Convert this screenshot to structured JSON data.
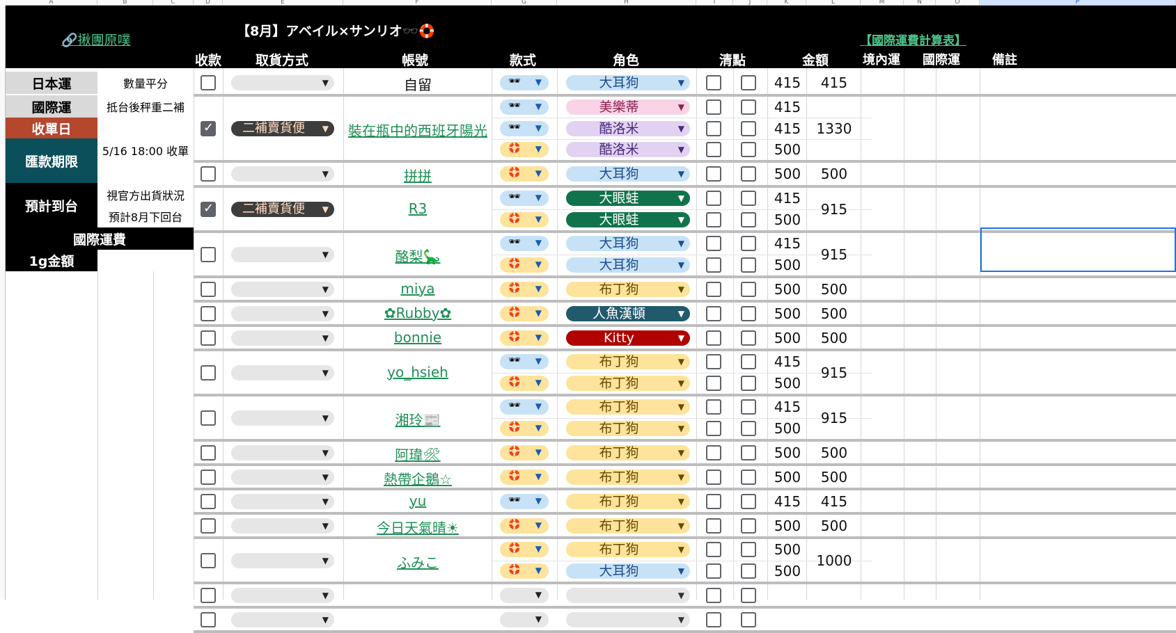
{
  "columns": [
    "A",
    "B",
    "C",
    "D",
    "E",
    "F",
    "G",
    "H",
    "I",
    "J",
    "K",
    "L",
    "M",
    "N",
    "O",
    "P"
  ],
  "header": {
    "link_left": "🔗揪團原噗",
    "title": "【8月】アベイル×サンリオ🕶️🛟",
    "link_right": "【國際運費計算表】",
    "cols": {
      "paid": "收款",
      "pickup": "取貨方式",
      "account": "帳號",
      "style": "款式",
      "character": "角色",
      "check": "清點",
      "amount": "金額",
      "domestic": "境內運",
      "intl": "國際運",
      "note": "備註"
    }
  },
  "info": {
    "jp_ship_label": "日本運",
    "jp_ship_val": "數量平分",
    "intl_ship_label": "國際運",
    "intl_ship_val": "抵台後秤重二補",
    "close_label": "收單日",
    "close_val": "5/16 18:00 收單",
    "pay_label": "匯款期限",
    "arrival_label": "預計到台",
    "arrival_val1": "視官方出貨狀況",
    "arrival_val2": "預計8月下回台",
    "intl_fee_label": "國際運費",
    "per_g_label": "1g金額"
  },
  "glyphs": {
    "glasses": "🕶",
    "ring": "🛟",
    "arrow": "▼"
  },
  "colors": {
    "blue_chip": "#c7e2f6",
    "pink_chip": "#f9d3e6",
    "purple_chip": "#e2d2f2",
    "green_chip": "#11734b",
    "orange_chip": "#fde39b",
    "teal_chip": "#215a6c",
    "red_chip": "#b10202",
    "dark_chip": "#3d3d3d",
    "gray_chip": "#e6e6e6",
    "close_red": "#b5472d",
    "pay_teal": "#0b4f5a"
  },
  "pickup_option": "二補賣貨便",
  "rows": [
    {
      "account": "自留",
      "link": false,
      "paid": false,
      "pickup": "",
      "total": "415",
      "items": [
        {
          "style": "glasses",
          "char": "大耳狗",
          "cc": "blue",
          "amt": "415"
        }
      ]
    },
    {
      "account": "裝在瓶中的西班牙陽光",
      "link": true,
      "paid": true,
      "pickup": "二補賣貨便",
      "total": "1330",
      "items": [
        {
          "style": "glasses",
          "char": "美樂蒂",
          "cc": "pink",
          "amt": "415"
        },
        {
          "style": "glasses",
          "char": "酷洛米",
          "cc": "purple",
          "amt": "415"
        },
        {
          "style": "ring",
          "char": "酷洛米",
          "cc": "purple",
          "amt": "500"
        }
      ]
    },
    {
      "account": "拼拼",
      "link": true,
      "paid": false,
      "pickup": "",
      "total": "500",
      "items": [
        {
          "style": "ring",
          "char": "大耳狗",
          "cc": "blue",
          "amt": "500"
        }
      ]
    },
    {
      "account": "R3",
      "link": true,
      "paid": true,
      "pickup": "二補賣貨便",
      "total": "915",
      "items": [
        {
          "style": "glasses",
          "char": "大眼蛙",
          "cc": "green",
          "amt": "415"
        },
        {
          "style": "ring",
          "char": "大眼蛙",
          "cc": "green",
          "amt": "500"
        }
      ]
    },
    {
      "account": "酪梨🦕",
      "link": true,
      "paid": false,
      "pickup": "",
      "total": "915",
      "items": [
        {
          "style": "glasses",
          "char": "大耳狗",
          "cc": "blue",
          "amt": "415"
        },
        {
          "style": "ring",
          "char": "大耳狗",
          "cc": "blue",
          "amt": "500"
        }
      ]
    },
    {
      "account": "miya",
      "link": true,
      "paid": false,
      "pickup": "",
      "total": "500",
      "items": [
        {
          "style": "ring",
          "char": "布丁狗",
          "cc": "orange",
          "amt": "500"
        }
      ]
    },
    {
      "account": "✿Rubby✿",
      "link": true,
      "paid": false,
      "pickup": "",
      "total": "500",
      "items": [
        {
          "style": "ring",
          "char": "人魚漢頓",
          "cc": "teal",
          "amt": "500"
        }
      ]
    },
    {
      "account": "bonnie",
      "link": true,
      "paid": false,
      "pickup": "",
      "total": "500",
      "items": [
        {
          "style": "ring",
          "char": "Kitty",
          "cc": "red",
          "amt": "500"
        }
      ]
    },
    {
      "account": "yo_hsieh",
      "link": true,
      "paid": false,
      "pickup": "",
      "total": "915",
      "items": [
        {
          "style": "glasses",
          "char": "布丁狗",
          "cc": "orange",
          "amt": "415"
        },
        {
          "style": "ring",
          "char": "布丁狗",
          "cc": "orange",
          "amt": "500"
        }
      ]
    },
    {
      "account": "湘玲📰",
      "link": true,
      "paid": false,
      "pickup": "",
      "total": "915",
      "items": [
        {
          "style": "glasses",
          "char": "布丁狗",
          "cc": "orange",
          "amt": "415"
        },
        {
          "style": "ring",
          "char": "布丁狗",
          "cc": "orange",
          "amt": "500"
        }
      ]
    },
    {
      "account": "阿瑋🛠",
      "link": true,
      "paid": false,
      "pickup": "",
      "total": "500",
      "items": [
        {
          "style": "ring",
          "char": "布丁狗",
          "cc": "orange",
          "amt": "500"
        }
      ]
    },
    {
      "account": "熱帶企鵝☆",
      "link": true,
      "paid": false,
      "pickup": "",
      "total": "500",
      "items": [
        {
          "style": "ring",
          "char": "布丁狗",
          "cc": "orange",
          "amt": "500"
        }
      ]
    },
    {
      "account": "yu",
      "link": true,
      "paid": false,
      "pickup": "",
      "total": "415",
      "items": [
        {
          "style": "glasses",
          "char": "布丁狗",
          "cc": "orange",
          "amt": "415"
        }
      ]
    },
    {
      "account": "今日天氣晴☀",
      "link": true,
      "paid": false,
      "pickup": "",
      "total": "500",
      "items": [
        {
          "style": "ring",
          "char": "布丁狗",
          "cc": "orange",
          "amt": "500"
        }
      ]
    },
    {
      "account": "ふみこ",
      "link": true,
      "paid": false,
      "pickup": "",
      "total": "1000",
      "items": [
        {
          "style": "ring",
          "char": "布丁狗",
          "cc": "orange",
          "amt": "500"
        },
        {
          "style": "ring",
          "char": "大耳狗",
          "cc": "blue",
          "amt": "500"
        }
      ]
    },
    {
      "account": "",
      "link": false,
      "paid": false,
      "pickup": "",
      "total": "",
      "items": [
        {
          "style": "",
          "char": "",
          "cc": "gray",
          "amt": ""
        }
      ]
    },
    {
      "account": "",
      "link": false,
      "paid": false,
      "pickup": "",
      "total": "",
      "items": [
        {
          "style": "",
          "char": "",
          "cc": "gray",
          "amt": ""
        }
      ]
    }
  ]
}
